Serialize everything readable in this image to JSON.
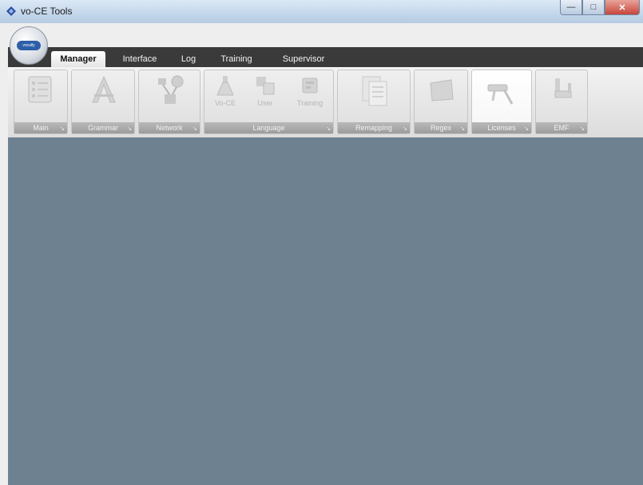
{
  "window": {
    "title": "vo-CE Tools",
    "controls": {
      "minimize": "—",
      "maximize": "□",
      "close": "✕"
    }
  },
  "quick_access": {
    "arrow": "=",
    "orb_text": "vocally"
  },
  "tabs": [
    {
      "label": "Manager",
      "active": true
    },
    {
      "label": "Interface",
      "active": false
    },
    {
      "label": "Log",
      "active": false
    },
    {
      "label": "Training",
      "active": false
    },
    {
      "label": "Supervisor",
      "active": false
    }
  ],
  "ribbon": {
    "groups": [
      {
        "label": "Main",
        "icon": "checklist-icon"
      },
      {
        "label": "Grammar",
        "icon": "compass-icon"
      },
      {
        "label": "Network",
        "icon": "network-icon"
      },
      {
        "label": "Language",
        "buttons": [
          {
            "label": "Vo-CE",
            "icon": "flask-icon"
          },
          {
            "label": "User",
            "icon": "users-icon"
          },
          {
            "label": "Training",
            "icon": "training-icon"
          }
        ]
      },
      {
        "label": "Remapping",
        "icon": "documents-icon"
      },
      {
        "label": "Regex",
        "icon": "box-icon"
      },
      {
        "label": "Licenses",
        "icon": "tools-icon"
      },
      {
        "label": "EMF",
        "icon": "chair-icon"
      }
    ],
    "launcher_glyph": "↘"
  },
  "colors": {
    "workspace": "#6e8191",
    "tabbar": "#3a3a3a",
    "ribbon": "#e6e6e6"
  }
}
